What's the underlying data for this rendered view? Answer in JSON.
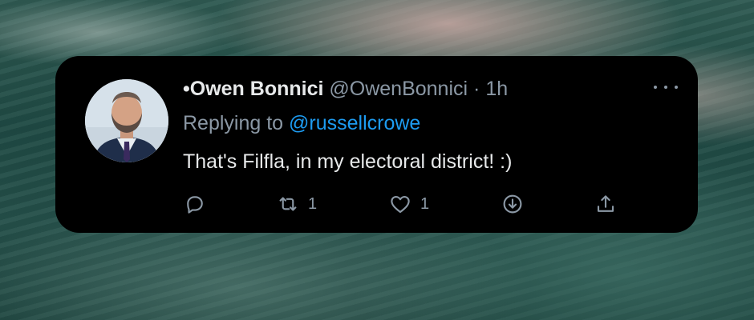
{
  "tweet": {
    "author_name": "•Owen Bonnici",
    "handle": "@OwenBonnici",
    "separator": "·",
    "time": "1h",
    "replying_prefix": "Replying to",
    "replying_to": "@russellcrowe",
    "text": "That's Filfla, in my electoral district! :)",
    "more_icon": "more-horizontal-icon",
    "actions": {
      "reply": {
        "icon": "reply-icon",
        "count": ""
      },
      "retweet": {
        "icon": "retweet-icon",
        "count": "1"
      },
      "like": {
        "icon": "heart-icon",
        "count": "1"
      },
      "download": {
        "icon": "download-icon",
        "count": ""
      },
      "share": {
        "icon": "share-icon",
        "count": ""
      }
    }
  },
  "colors": {
    "card_background": "#000000",
    "name_text": "#e7e9ea",
    "secondary_text": "#8b98a5",
    "link": "#1d9bf0"
  }
}
